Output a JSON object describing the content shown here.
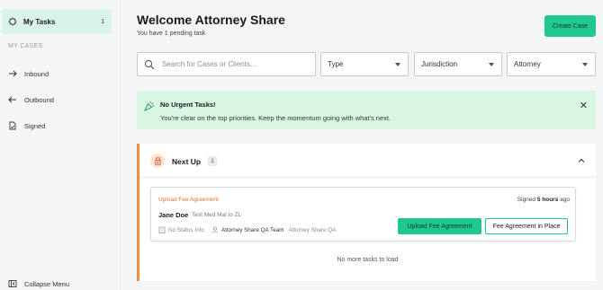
{
  "sidebar": {
    "my_tasks_label": "My Tasks",
    "my_tasks_count": "1",
    "section_label": "MY CASES",
    "items": [
      {
        "label": "Inbound",
        "icon": "arrow-right-icon"
      },
      {
        "label": "Outbound",
        "icon": "arrow-left-icon"
      },
      {
        "label": "Signed",
        "icon": "signed-document-icon"
      }
    ],
    "collapse_label": "Collapse Menu"
  },
  "header": {
    "title": "Welcome Attorney Share",
    "subtitle": "You have 1 pending task",
    "create_case_label": "Create Case"
  },
  "filters": {
    "search_placeholder": "Search for Cases or Clients...",
    "type": "Type",
    "jurisdiction": "Jurisdiction",
    "attorney": "Attorney"
  },
  "banner": {
    "title": "No Urgent Tasks!",
    "text": "You're clear on the top priorities. Keep the momentum going with what's next."
  },
  "next_up": {
    "label": "Next Up",
    "count": "1",
    "task": {
      "status": "Upload Fee Agreement",
      "signed_prefix": "Signed",
      "signed_time": "5 hours",
      "signed_suffix": "ago",
      "client_name": "Jane Doe",
      "case_name": "Test Med Mal to ZL",
      "status_info": "No Status Info",
      "team": "Attorney Share QA Team",
      "firm": "Attorney Share QA",
      "primary_action": "Upload Fee Agreement",
      "secondary_action": "Fee Agreement in Place"
    },
    "empty_text": "No more tasks to load"
  },
  "colors": {
    "accent": "#1fc98e",
    "warning": "#f28b3a",
    "banner_bg": "#d8f7e2",
    "active_nav_bg": "#d9f3ec"
  }
}
